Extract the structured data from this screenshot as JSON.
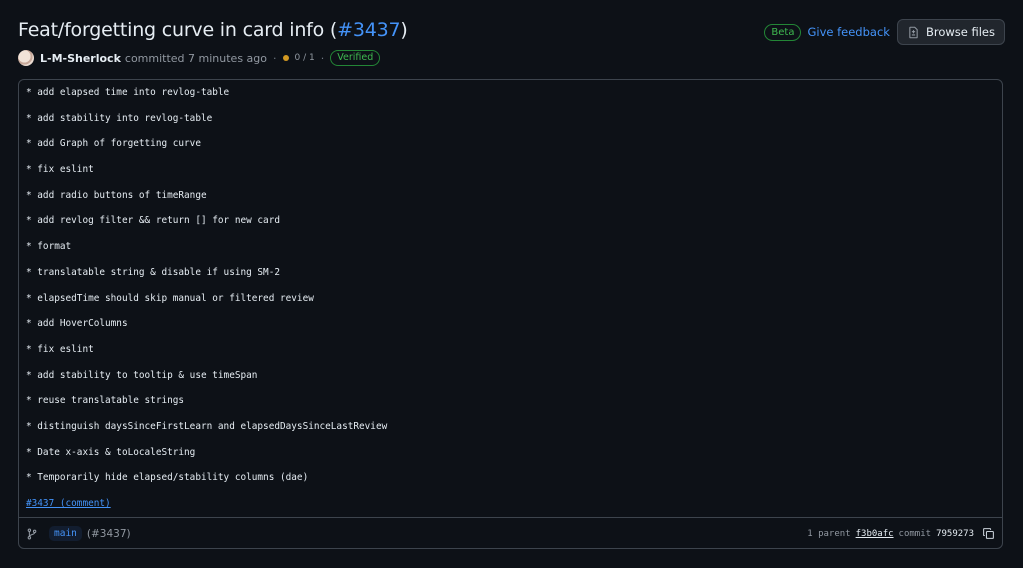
{
  "header": {
    "title": "Feat/forgetting curve in card info (",
    "pr_number": "#3437",
    "title_suffix": ")",
    "beta_badge": "Beta",
    "feedback_label": "Give feedback",
    "browse_files_label": "Browse files"
  },
  "meta": {
    "author": "L-M-Sherlock",
    "action_text": "committed 7 minutes ago",
    "separator": "·",
    "checks": "0 / 1",
    "verified_label": "Verified",
    "status_color": "#d29922"
  },
  "message_lines": [
    "* add elapsed time into revlog-table",
    "* add stability into revlog-table",
    "* add Graph of forgetting curve",
    "* fix eslint",
    "* add radio buttons of timeRange",
    "* add revlog filter && return [] for new card",
    "* format",
    "* translatable string & disable if using SM-2",
    "* elapsedTime should skip manual or filtered review",
    "* add HoverColumns",
    "* fix eslint",
    "* add stability to tooltip & use timeSpan",
    "* reuse translatable strings",
    "* distinguish daysSinceFirstLearn and elapsedDaysSinceLastReview",
    "* Date x-axis & toLocaleString",
    "* Temporarily hide elapsed/stability columns (dae)"
  ],
  "comment_link": "#3437 (comment)",
  "footer": {
    "branch": "main",
    "pr_ref": "(#3437)",
    "parent_label": "1 parent",
    "parent_sha": "f3b0afc",
    "commit_label": "commit",
    "commit_sha": "7959273"
  },
  "colors": {
    "background": "#0d1117",
    "link": "#4493f8",
    "success": "#3fb950",
    "border": "#3d444d"
  },
  "icons": [
    "file-diff-icon",
    "avatar",
    "status-dot-icon",
    "git-branch-icon",
    "copy-icon"
  ]
}
